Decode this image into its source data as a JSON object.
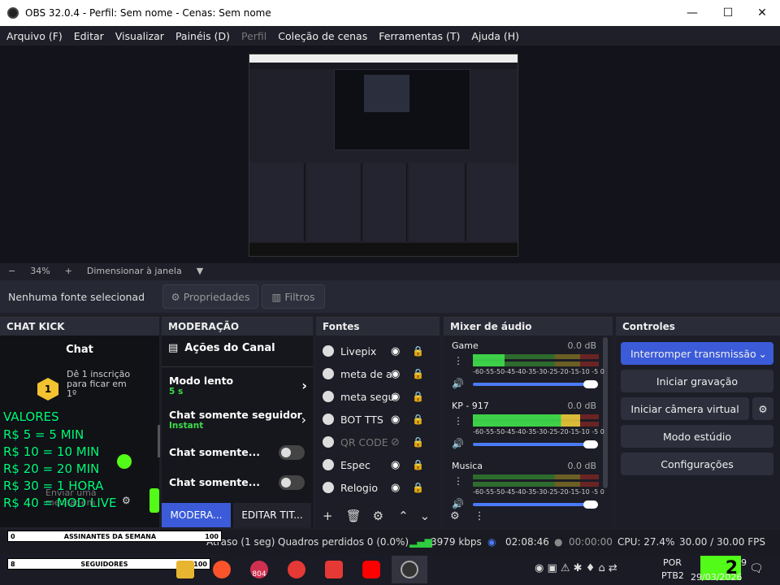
{
  "window": {
    "title": "OBS 32.0.4 - Perfil: Sem nome - Cenas: Sem nome",
    "controls": [
      "—",
      "☐",
      "✕"
    ]
  },
  "menu": [
    {
      "label": "Arquivo (F)",
      "disabled": false
    },
    {
      "label": "Editar",
      "disabled": false
    },
    {
      "label": "Visualizar",
      "disabled": false
    },
    {
      "label": "Painéis (D)",
      "disabled": false
    },
    {
      "label": "Perfil",
      "disabled": true
    },
    {
      "label": "Coleção de cenas",
      "disabled": false
    },
    {
      "label": "Ferramentas (T)",
      "disabled": false
    },
    {
      "label": "Ajuda (H)",
      "disabled": false
    }
  ],
  "zoom": {
    "minus": "−",
    "value": "34%",
    "plus": "+",
    "fit_label": "Dimensionar à janela"
  },
  "source_toolbar": {
    "no_selection": "Nenhuma fonte selecionad",
    "properties": "Propriedades",
    "filters": "Filtros"
  },
  "chat": {
    "header": "CHAT KICK",
    "title": "Chat",
    "badge": "1",
    "promo": "Dê 1 inscrição para ficar em 1º",
    "input_placeholder": "Enviar uma mensagem",
    "overlay_lines": [
      "VALORES",
      "R$ 5 = 5 MIN",
      "R$ 10 = 10 MIN",
      "R$ 20 = 20 MIN",
      "R$ 30 = 1 HORA",
      "R$ 40 = MOD LIVE"
    ]
  },
  "moderation": {
    "header": "MODERAÇÃO",
    "section": "Ações do Canal",
    "items": [
      {
        "label": "Modo lento",
        "sub": "5 s"
      },
      {
        "label": "Chat somente seguidor",
        "sub": "Instant"
      },
      {
        "label": "Chat somente..."
      },
      {
        "label": "Chat somente..."
      }
    ],
    "tabs": [
      "MODERA...",
      "EDITAR TIT..."
    ]
  },
  "sources": {
    "header": "Fontes",
    "items": [
      {
        "label": "Livepix",
        "visible": true
      },
      {
        "label": "meta de a",
        "visible": true
      },
      {
        "label": "meta segu",
        "visible": true
      },
      {
        "label": "BOT TTS",
        "visible": true
      },
      {
        "label": "QR CODE",
        "visible": false
      },
      {
        "label": "Espec",
        "visible": true
      },
      {
        "label": "Relogio",
        "visible": true
      }
    ]
  },
  "mixer": {
    "header": "Mixer de áudio",
    "scale": "-60-55-50-45-40-35-30-25-20-15-10 -5  0",
    "channels": [
      {
        "name": "Game",
        "db": "0.0 dB",
        "level": 0.25
      },
      {
        "name": "KP - 917",
        "db": "0.0 dB",
        "level": 0.85
      },
      {
        "name": "Musica",
        "db": "0.0 dB",
        "level": 0.0
      }
    ]
  },
  "controls": {
    "header": "Controles",
    "stream_btn": "Interromper transmissão",
    "record_btn": "Iniciar gravação",
    "virtualcam_btn": "Iniciar câmera virtual",
    "studio_btn": "Modo estúdio",
    "settings_btn": "Configurações"
  },
  "status": {
    "delay": "Atraso (1 seg)",
    "dropped": "Quadros perdidos 0 (0.0%)",
    "bitrate": "3979 kbps",
    "stream_time": "02:08:46",
    "rec_time": "00:00:00",
    "cpu": "CPU: 27.4%",
    "fps": "30.00 / 30.00 FPS"
  },
  "overlay_bars": [
    {
      "left_num": "0",
      "label": "ASSINANTES DA SEMANA",
      "right_num": "100"
    },
    {
      "left_num": "8",
      "label": "SEGUIDORES",
      "right_num": "100"
    }
  ],
  "taskbar": {
    "lang": "POR",
    "layout": "PTB2",
    "date": "29/03/2026",
    "clock_partial": "9",
    "badge_804": "804",
    "logo": "2"
  }
}
